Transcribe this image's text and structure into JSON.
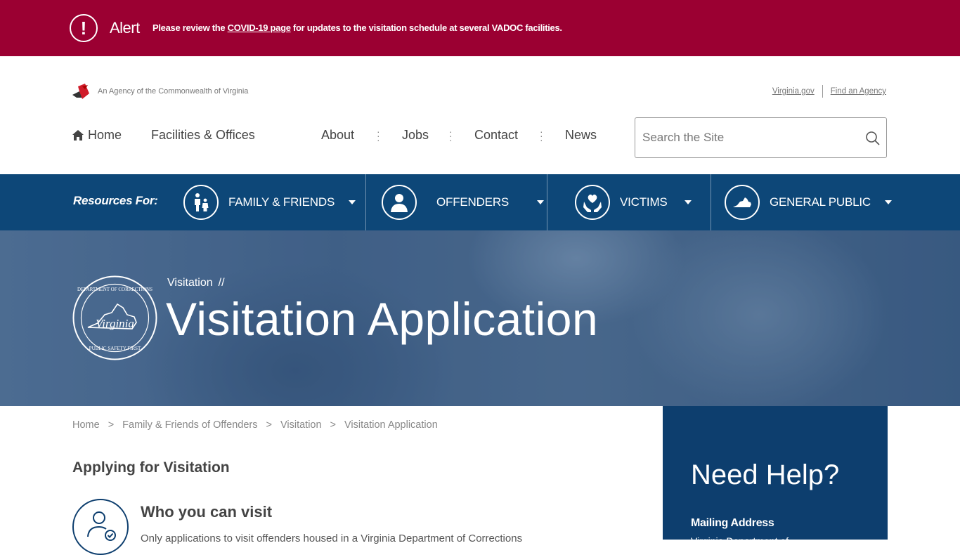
{
  "alert": {
    "title": "Alert",
    "message_before": "Please review the ",
    "link": "COVID-19 page",
    "message_after": " for updates to the visitation schedule at several VADOC facilities."
  },
  "utility": {
    "agency_text": "An Agency of the Commonwealth of Virginia",
    "links": [
      "Virginia.gov",
      "Find an Agency"
    ]
  },
  "nav": {
    "home": "Home",
    "facilities": "Facilities & Offices",
    "about": "About",
    "jobs": "Jobs",
    "contact": "Contact",
    "news": "News"
  },
  "search": {
    "placeholder": "Search the Site"
  },
  "resources": {
    "label": "Resources For:",
    "items": [
      {
        "label": "FAMILY & FRIENDS",
        "icon": "family-icon"
      },
      {
        "label": "OFFENDERS",
        "icon": "person-icon"
      },
      {
        "label": "VICTIMS",
        "icon": "heart-hands-icon"
      },
      {
        "label": "GENERAL PUBLIC",
        "icon": "virginia-state-icon"
      }
    ]
  },
  "hero": {
    "crumb": "Visitation",
    "crumb_sep": "//",
    "title": "Visitation Application"
  },
  "breadcrumb": [
    "Home",
    "Family & Friends of Offenders",
    "Visitation",
    "Visitation Application"
  ],
  "breadcrumb_sep": ">",
  "content": {
    "section_title": "Applying for Visitation",
    "visit_title": "Who you can visit",
    "visit_body": "Only applications to visit offenders housed in a Virginia Department of Corrections"
  },
  "help": {
    "title": "Need Help?",
    "mailing_label": "Mailing Address",
    "mailing_line1": "Virginia Department of"
  },
  "colors": {
    "alert_bg": "#9b0032",
    "nav_bar_bg": "#0d4778",
    "sidebar_bg": "#0d3e6e"
  }
}
